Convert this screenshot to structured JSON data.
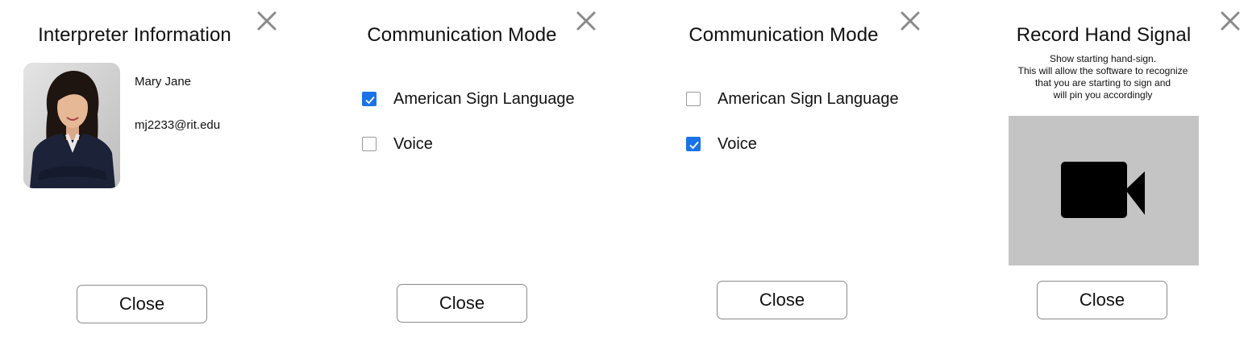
{
  "panels": [
    {
      "title": "Interpreter Information",
      "name": "Mary Jane",
      "email": "mj2233@rit.edu",
      "close_label": "Close"
    },
    {
      "title": "Communication Mode",
      "options": [
        {
          "label": "American Sign Language",
          "checked": true
        },
        {
          "label": "Voice",
          "checked": false
        }
      ],
      "close_label": "Close"
    },
    {
      "title": "Communication Mode",
      "options": [
        {
          "label": "American Sign Language",
          "checked": false
        },
        {
          "label": "Voice",
          "checked": true
        }
      ],
      "close_label": "Close"
    },
    {
      "title": "Record Hand Signal",
      "description": [
        "Show starting hand-sign.",
        "This will allow the software to recognize",
        "that you are starting to sign and",
        "will pin you accordingly"
      ],
      "record_icon": "video-camera-icon",
      "close_label": "Close"
    }
  ],
  "colors": {
    "checkbox_checked": "#1a73e8",
    "close_x": "#8a8a8a",
    "video_placeholder": "#c4c4c4"
  }
}
